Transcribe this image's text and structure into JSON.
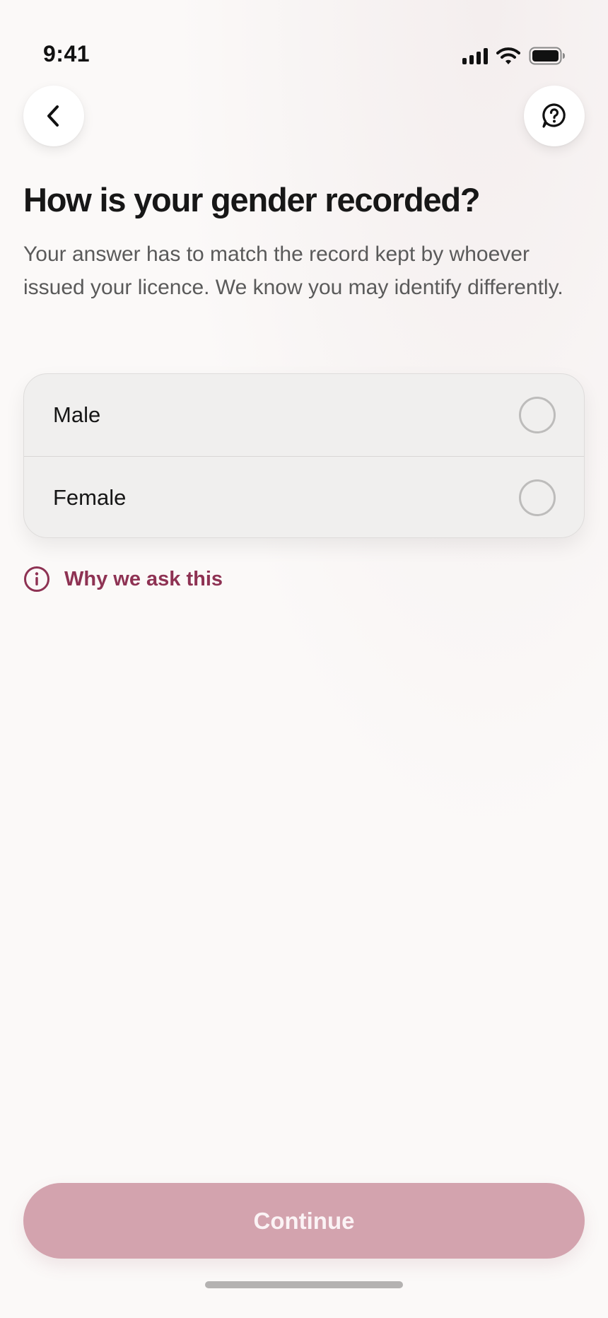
{
  "status_bar": {
    "time": "9:41",
    "icons": [
      "signal-icon",
      "wifi-icon",
      "battery-icon"
    ]
  },
  "header": {
    "back_icon": "chevron-left-icon",
    "help_icon": "question-chat-icon"
  },
  "main": {
    "title": "How is your gender recorded?",
    "subtitle": "Your answer has to match the record kept by whoever issued your licence. We know you may identify differently.",
    "options": [
      {
        "label": "Male",
        "selected": false
      },
      {
        "label": "Female",
        "selected": false
      }
    ],
    "why_link": {
      "icon": "info-icon",
      "label": "Why we ask this"
    }
  },
  "footer": {
    "continue_label": "Continue",
    "continue_enabled": false
  },
  "colors": {
    "accent": "#8e3253",
    "button_disabled": "#d3a3ae",
    "background": "#fbf9f8"
  }
}
